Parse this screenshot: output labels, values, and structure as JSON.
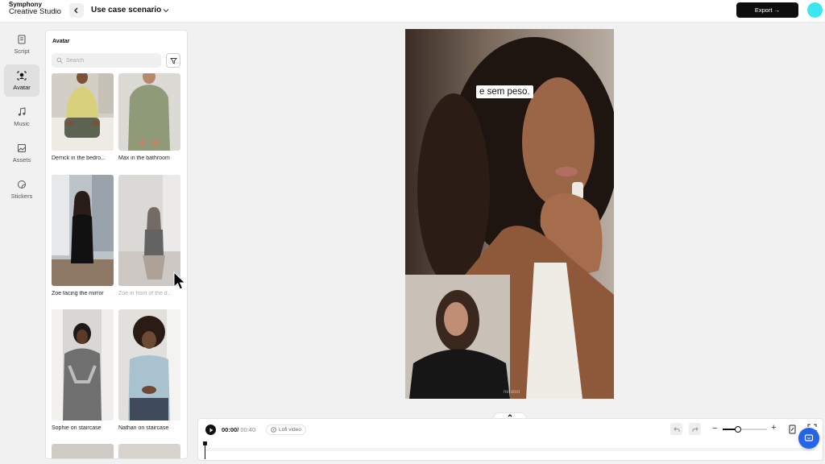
{
  "brand": {
    "line1": "Symphony",
    "line2": "Creative Studio"
  },
  "header": {
    "project_title": "Use case scenario",
    "export_label": "Export →"
  },
  "rail": [
    {
      "label": "Script",
      "icon": "script-icon",
      "active": false
    },
    {
      "label": "Avatar",
      "icon": "avatar-icon",
      "active": true
    },
    {
      "label": "Music",
      "icon": "music-note-icon",
      "active": false
    },
    {
      "label": "Assets",
      "icon": "image-icon",
      "active": false
    },
    {
      "label": "Stickers",
      "icon": "sticker-icon",
      "active": false
    }
  ],
  "panel": {
    "title": "Avatar",
    "search_placeholder": "Search",
    "cards": [
      {
        "label": "Derrick in the bedro..."
      },
      {
        "label": "Max in the bathroom"
      },
      {
        "label": "Zoe facing the mirror"
      },
      {
        "label": "Zoe in front of the d..."
      },
      {
        "label": "Sophie on staircase"
      },
      {
        "label": "Nathan on staircase"
      }
    ]
  },
  "canvas": {
    "caption": "e sem peso."
  },
  "timeline": {
    "current_time": "00:00",
    "separator": "/",
    "total_time": "00:40",
    "music_label": "Lofi video",
    "zoom_level": 0.35
  },
  "colors": {
    "accent": "#3ce6ef",
    "export_bg": "#0e0e0e",
    "chat_bg": "#2563eb"
  }
}
